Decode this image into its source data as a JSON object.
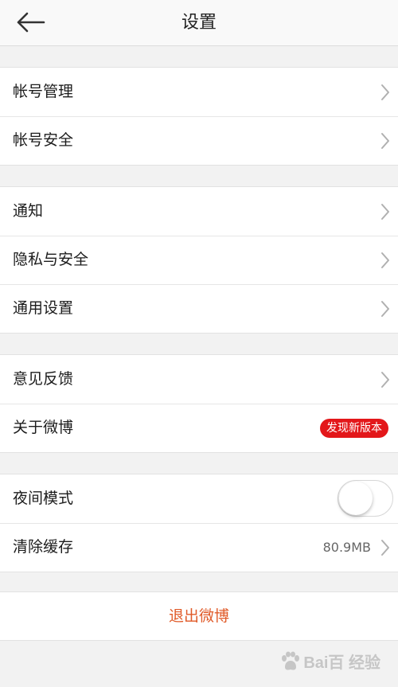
{
  "header": {
    "title": "设置",
    "back_icon": "back-arrow-icon"
  },
  "groups": [
    {
      "items": [
        {
          "label": "帐号管理",
          "icon": "chevron-right-icon"
        },
        {
          "label": "帐号安全",
          "icon": "chevron-right-icon"
        }
      ]
    },
    {
      "items": [
        {
          "label": "通知",
          "icon": "chevron-right-icon"
        },
        {
          "label": "隐私与安全",
          "icon": "chevron-right-icon"
        },
        {
          "label": "通用设置",
          "icon": "chevron-right-icon"
        }
      ]
    },
    {
      "items": [
        {
          "label": "意见反馈",
          "icon": "chevron-right-icon"
        },
        {
          "label": "关于微博",
          "badge": "发现新版本"
        }
      ]
    },
    {
      "items": [
        {
          "label": "夜间模式",
          "toggle": false
        },
        {
          "label": "清除缓存",
          "value": "80.9MB",
          "icon": "chevron-right-icon"
        }
      ]
    }
  ],
  "logout": {
    "label": "退出微博"
  },
  "watermark": {
    "text": "Bai百 经验"
  },
  "colors": {
    "badge": "#e3171a",
    "logout": "#e05a28",
    "background": "#f2f2f2"
  }
}
